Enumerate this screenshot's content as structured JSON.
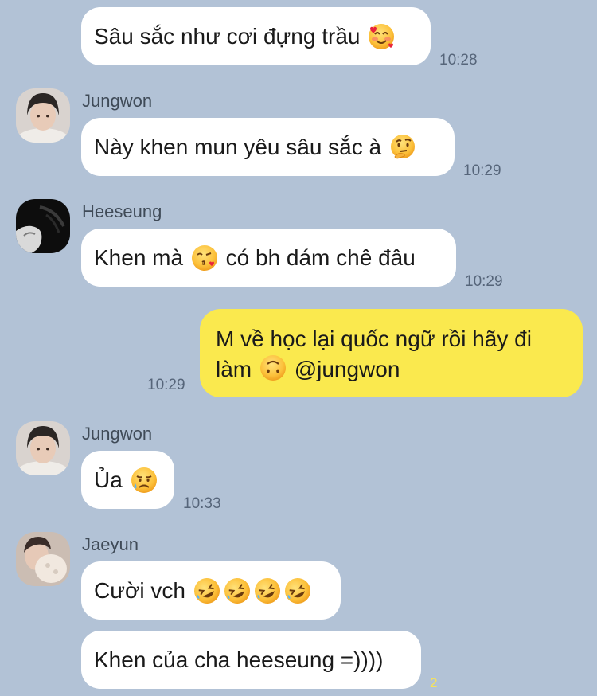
{
  "messages": [
    {
      "text_a": "Sâu sắc như cơi đựng trầu",
      "emoji": "smiling-face-with-hearts-icon",
      "time": "10:28"
    },
    {
      "sender": "Jungwon",
      "avatar": "jungwon-avatar",
      "text_a": "Này khen mun yêu sâu sắc à",
      "emoji": "thinking-face-icon",
      "time": "10:29"
    },
    {
      "sender": "Heeseung",
      "avatar": "heeseung-avatar",
      "text_a": "Khen mà",
      "emoji": "face-blowing-kiss-icon",
      "text_b": "có bh dám chê đâu",
      "time": "10:29"
    },
    {
      "own": true,
      "text_a": "M về học lại quốc ngữ rồi hãy đi làm",
      "emoji": "upside-down-face-icon",
      "text_b": "@jungwon",
      "time": "10:29"
    },
    {
      "sender": "Jungwon",
      "avatar": "jungwon-avatar",
      "text_a": "Ủa",
      "emoji": "sad-but-relieved-face-icon",
      "time": "10:33"
    },
    {
      "sender": "Jaeyun",
      "avatar": "jaeyun-avatar",
      "text_a": "Cười vch",
      "emoji": "rolling-on-floor-laughing-icon",
      "emoji_count": 4
    },
    {
      "text_a": "Khen của cha heeseung =))))",
      "unread_count": "2"
    }
  ],
  "colors": {
    "background": "#b2c2d6",
    "incoming_bubble": "#ffffff",
    "outgoing_bubble": "#fae94e",
    "timestamp": "#56657a",
    "unread": "#f7e35a"
  }
}
